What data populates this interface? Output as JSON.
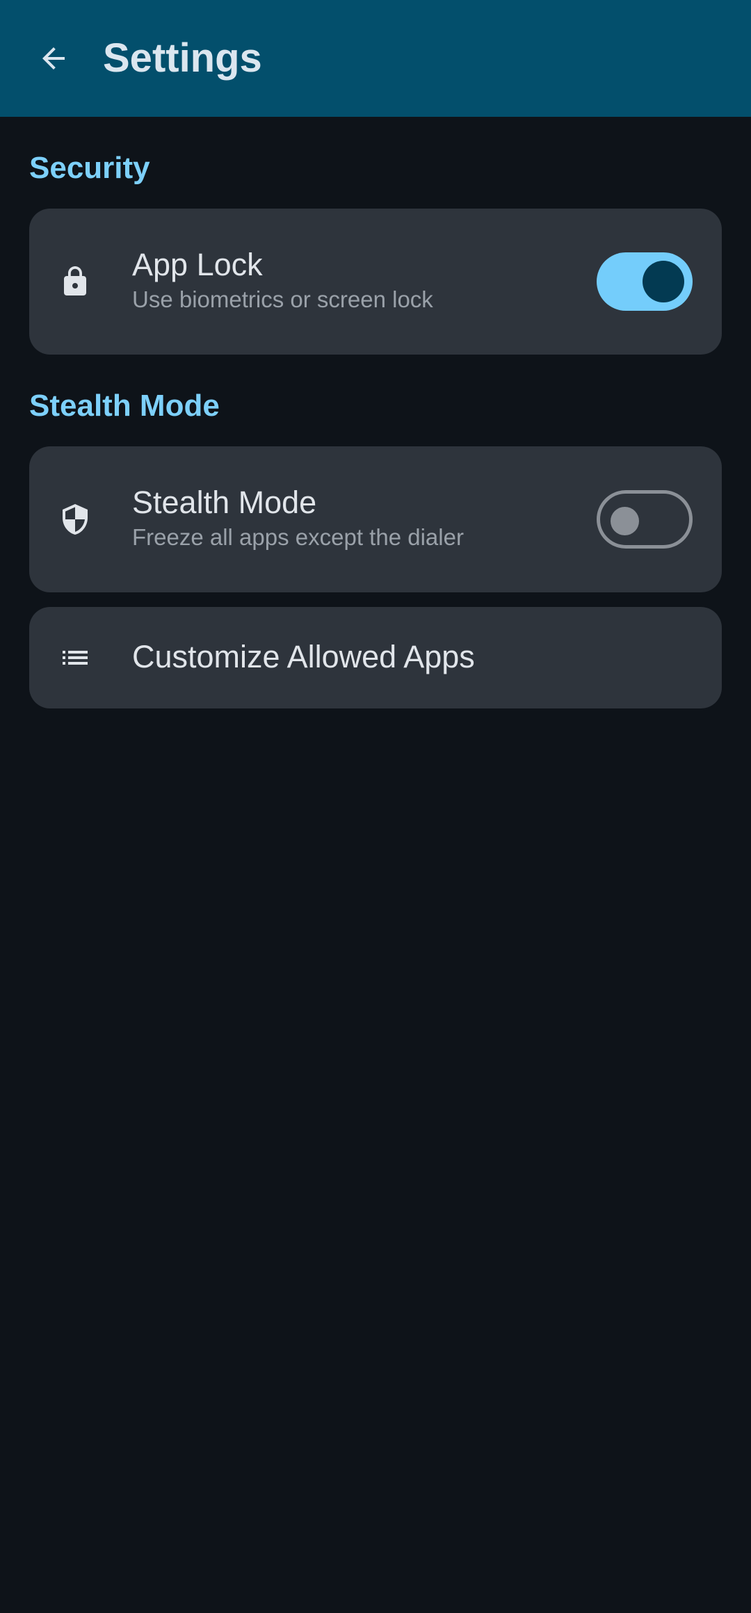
{
  "app_bar": {
    "title": "Settings",
    "back_icon": "arrow-back-icon"
  },
  "sections": [
    {
      "header": "Security",
      "items": [
        {
          "icon": "lock-icon",
          "title": "App Lock",
          "subtitle": "Use biometrics or screen lock",
          "toggle": true
        }
      ]
    },
    {
      "header": "Stealth Mode",
      "items": [
        {
          "icon": "shield-icon",
          "title": "Stealth Mode",
          "subtitle": "Freeze all apps except the dialer",
          "toggle": false
        },
        {
          "icon": "list-icon",
          "title": "Customize Allowed Apps"
        }
      ]
    }
  ],
  "colors": {
    "background": "#0e1319",
    "app_bar": "#034f6c",
    "accent": "#7dd0fb",
    "card": "#2e343c"
  }
}
